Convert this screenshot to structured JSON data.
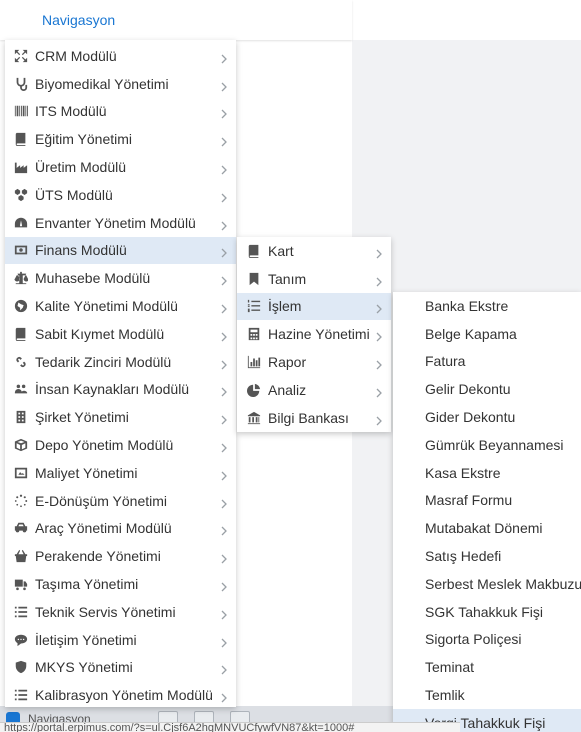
{
  "nav": {
    "title": "Navigasyon"
  },
  "main_menu": [
    {
      "label": "CRM Modülü",
      "icon": "expand-arrows-icon"
    },
    {
      "label": "Biyomedikal Yönetimi",
      "icon": "stethoscope-icon"
    },
    {
      "label": "ITS Modülü",
      "icon": "barcode-icon"
    },
    {
      "label": "Eğitim Yönetimi",
      "icon": "book-icon"
    },
    {
      "label": "Üretim Modülü",
      "icon": "factory-icon"
    },
    {
      "label": "ÜTS Modülü",
      "icon": "cubes-icon"
    },
    {
      "label": "Envanter Yönetim Modülü",
      "icon": "dashboard-icon"
    },
    {
      "label": "Finans Modülü",
      "icon": "money-icon",
      "active": true
    },
    {
      "label": "Muhasebe Modülü",
      "icon": "scale-icon"
    },
    {
      "label": "Kalite Yönetimi Modülü",
      "icon": "globe-icon"
    },
    {
      "label": "Sabit Kıymet Modülü",
      "icon": "book-icon"
    },
    {
      "label": "Tedarik Zinciri Modülü",
      "icon": "link-icon"
    },
    {
      "label": "İnsan Kaynakları Modülü",
      "icon": "users-icon"
    },
    {
      "label": "Şirket Yönetimi",
      "icon": "building-icon"
    },
    {
      "label": "Depo Yönetim Modülü",
      "icon": "cube-icon"
    },
    {
      "label": "Maliyet Yönetimi",
      "icon": "image-frame-icon"
    },
    {
      "label": "E-Dönüşüm Yönetimi",
      "icon": "spinner-icon"
    },
    {
      "label": "Araç Yönetimi Modülü",
      "icon": "car-icon"
    },
    {
      "label": "Perakende Yönetimi",
      "icon": "basket-icon"
    },
    {
      "label": "Taşıma Yönetimi",
      "icon": "truck-icon"
    },
    {
      "label": "Teknik Servis Yönetimi",
      "icon": "list-icon"
    },
    {
      "label": "İletişim Yönetimi",
      "icon": "chat-bubble-icon"
    },
    {
      "label": "MKYS Yönetimi",
      "icon": "shield-icon"
    },
    {
      "label": "Kalibrasyon Yönetim Modülü",
      "icon": "list-icon"
    }
  ],
  "sub_menu": [
    {
      "label": "Kart",
      "icon": "book-icon"
    },
    {
      "label": "Tanım",
      "icon": "bookmark-icon"
    },
    {
      "label": "İşlem",
      "icon": "list-ordered-icon",
      "active": true
    },
    {
      "label": "Hazine Yönetimi",
      "icon": "calculator-icon"
    },
    {
      "label": "Rapor",
      "icon": "bar-chart-icon"
    },
    {
      "label": "Analiz",
      "icon": "pie-chart-icon"
    },
    {
      "label": "Bilgi Bankası",
      "icon": "bank-icon"
    }
  ],
  "sub2_menu": [
    "Banka Ekstre",
    "Belge Kapama",
    "Fatura",
    "Gelir Dekontu",
    "Gider Dekontu",
    "Gümrük Beyannamesi",
    "Kasa Ekstre",
    "Masraf Formu",
    "Mutabakat Dönemi",
    "Satış Hedefi",
    "Serbest Meslek Makbuzu",
    "SGK Tahakkuk Fişi",
    "Sigorta Poliçesi",
    "Teminat",
    "Temlik",
    "Vergi Tahakkuk Fişi"
  ],
  "sub2_active_index": 15,
  "bottom_bar": {
    "tab_label": "Navigasyon"
  },
  "status_url": "https://portal.erpimus.com/?s=ul.Cjsf6A2hgMNVUCfywfVN87&kt=1000#",
  "colors": {
    "accent": "#1976d2",
    "active_bg": "#dfe9f5"
  }
}
